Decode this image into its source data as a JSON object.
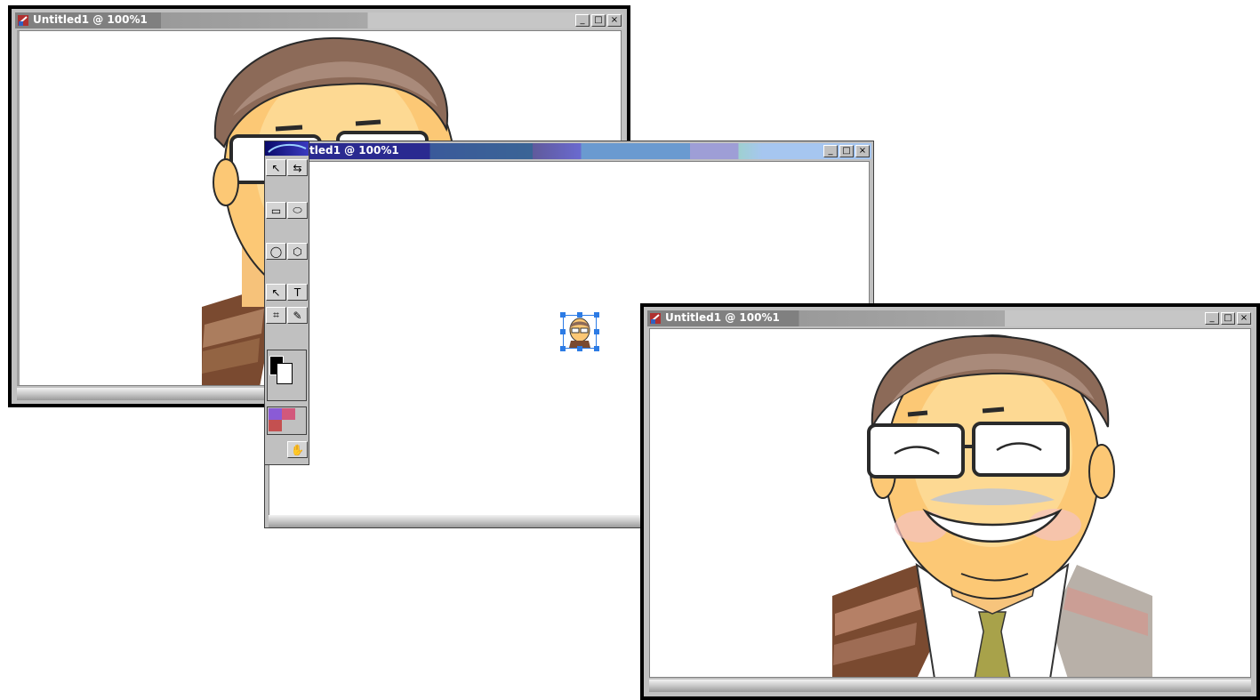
{
  "windows": {
    "back": {
      "title": "Untitled1 @ 100%1",
      "zoom": "100%"
    },
    "middle": {
      "title": "tled1 @ 100%1"
    },
    "front": {
      "title": "Untitled1 @ 100%1",
      "zoom": "100%"
    }
  },
  "window_controls": {
    "minimize": "_",
    "maximize": "□",
    "close": "×"
  },
  "toolbox": {
    "tools": [
      {
        "name": "pointer-tool-icon",
        "glyph": "↖"
      },
      {
        "name": "scale-tool-icon",
        "glyph": "⇆"
      },
      {
        "name": "rectangle-tool-icon",
        "glyph": "▭"
      },
      {
        "name": "ellipse-tool-icon",
        "glyph": "⬭"
      },
      {
        "name": "circle-tool-icon",
        "glyph": "◯"
      },
      {
        "name": "polygon-tool-icon",
        "glyph": "⬡"
      },
      {
        "name": "subselect-tool-icon",
        "glyph": "↖"
      },
      {
        "name": "text-tool-icon",
        "glyph": "T"
      },
      {
        "name": "crop-tool-icon",
        "glyph": "⌗"
      },
      {
        "name": "eyedropper-tool-icon",
        "glyph": "✎"
      },
      {
        "name": "zoom-tool-icon",
        "glyph": "🔍"
      },
      {
        "name": "hand-tool-icon",
        "glyph": "✋"
      }
    ],
    "colors": {
      "stroke": "#000000",
      "fill": "#ffffff",
      "swatch_a": "#8a5bd6",
      "swatch_b": "#d2587c",
      "swatch_c": "#c45050"
    }
  },
  "colors": {
    "title_active": "#2f2f9c",
    "title_inactive": "#808080",
    "selection": "#2c7be5"
  }
}
